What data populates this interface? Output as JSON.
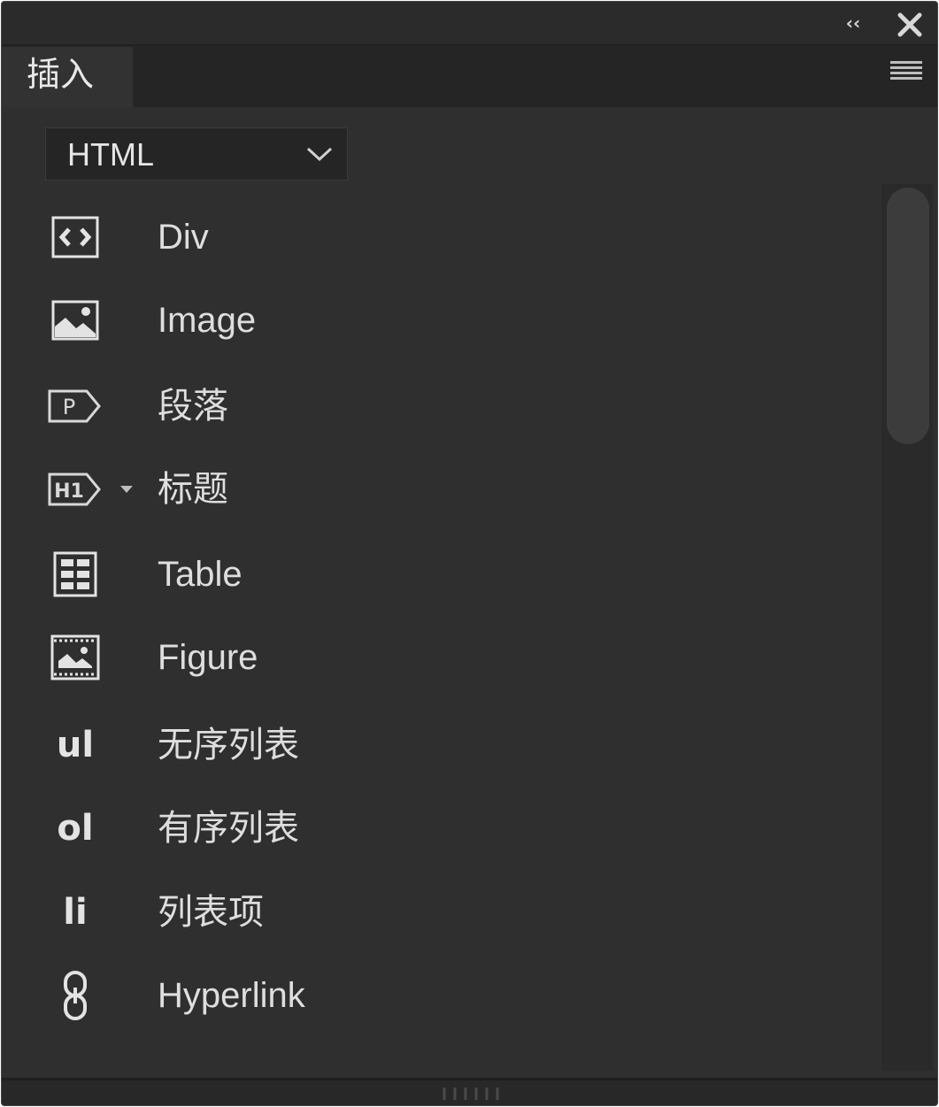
{
  "titlebar": {
    "collapse_label": "‹‹",
    "collapse_icon": "double-chevron-left-icon",
    "close_icon": "close-icon"
  },
  "tabs": [
    {
      "label": "插入",
      "active": true
    }
  ],
  "panel_menu_icon": "hamburger-menu-icon",
  "category_select": {
    "value": "HTML",
    "icon": "chevron-down-icon"
  },
  "items": [
    {
      "label": "Div",
      "icon": "div-code-icon"
    },
    {
      "label": "Image",
      "icon": "image-icon"
    },
    {
      "label": "段落",
      "icon": "paragraph-tag-icon"
    },
    {
      "label": "标题",
      "icon": "heading-tag-icon",
      "has_dropdown": true
    },
    {
      "label": "Table",
      "icon": "table-icon"
    },
    {
      "label": "Figure",
      "icon": "figure-icon"
    },
    {
      "label": "无序列表",
      "icon": "unordered-list-icon",
      "icon_text": "ul"
    },
    {
      "label": "有序列表",
      "icon": "ordered-list-icon",
      "icon_text": "ol"
    },
    {
      "label": "列表项",
      "icon": "list-item-icon",
      "icon_text": "li"
    },
    {
      "label": "Hyperlink",
      "icon": "hyperlink-icon"
    }
  ],
  "colors": {
    "panel_bg": "#2f2f2f",
    "titlebar_bg": "#2b2b2b",
    "tabstrip_bg": "#252525",
    "text": "#dedede",
    "icon": "#e3e3e3"
  }
}
